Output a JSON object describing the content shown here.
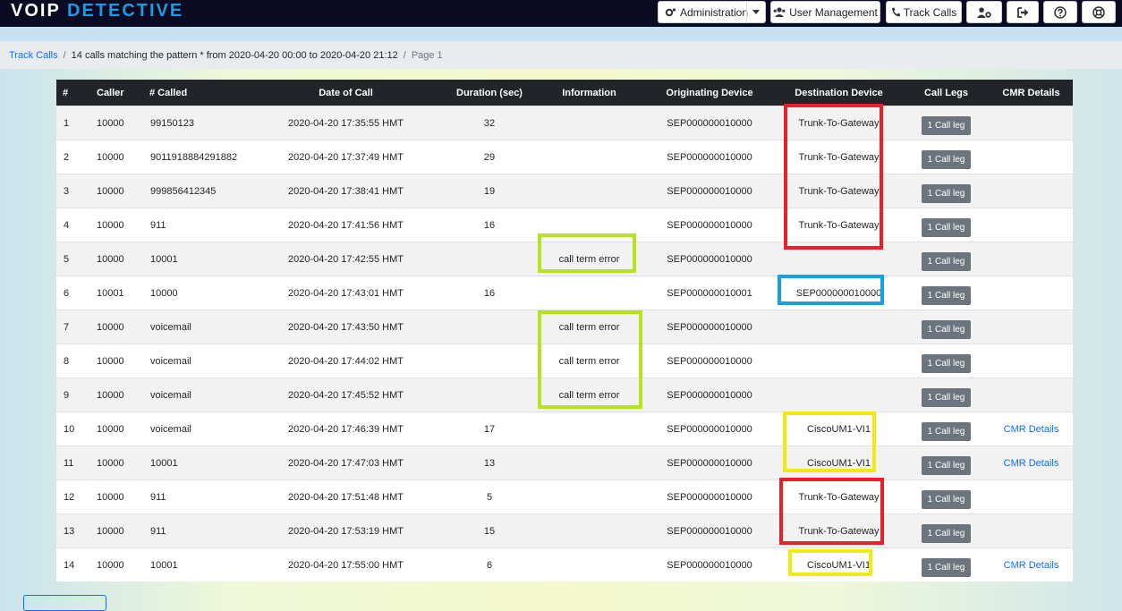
{
  "brand": {
    "part1": "VOIP",
    "part2": "DETECTIVE"
  },
  "navbar": {
    "administration": "Administration",
    "user_management": "User Management",
    "track_calls": "Track Calls"
  },
  "breadcrumb": {
    "root": "Track Calls",
    "query": "14 calls matching the pattern * from 2020-04-20 00:00 to 2020-04-20 21:12",
    "page": "Page 1"
  },
  "table": {
    "headers": [
      "#",
      "Caller",
      "# Called",
      "Date of Call",
      "Duration (sec)",
      "Information",
      "Originating Device",
      "Destination Device",
      "Call Legs",
      "CMR Details"
    ],
    "rows": [
      {
        "n": "1",
        "caller": "10000",
        "called": "99150123",
        "date": "2020-04-20 17:35:55 HMT",
        "duration": "32",
        "info": "",
        "orig": "SEP000000010000",
        "dest": "Trunk-To-Gateway",
        "legs": "1 Call leg",
        "cmr": ""
      },
      {
        "n": "2",
        "caller": "10000",
        "called": "9011918884291882",
        "date": "2020-04-20 17:37:49 HMT",
        "duration": "29",
        "info": "",
        "orig": "SEP000000010000",
        "dest": "Trunk-To-Gateway",
        "legs": "1 Call leg",
        "cmr": ""
      },
      {
        "n": "3",
        "caller": "10000",
        "called": "999856412345",
        "date": "2020-04-20 17:38:41 HMT",
        "duration": "19",
        "info": "",
        "orig": "SEP000000010000",
        "dest": "Trunk-To-Gateway",
        "legs": "1 Call leg",
        "cmr": ""
      },
      {
        "n": "4",
        "caller": "10000",
        "called": "911",
        "date": "2020-04-20 17:41:56 HMT",
        "duration": "16",
        "info": "",
        "orig": "SEP000000010000",
        "dest": "Trunk-To-Gateway",
        "legs": "1 Call leg",
        "cmr": ""
      },
      {
        "n": "5",
        "caller": "10000",
        "called": "10001",
        "date": "2020-04-20 17:42:55 HMT",
        "duration": "",
        "info": "call term error",
        "orig": "SEP000000010000",
        "dest": "",
        "legs": "1 Call leg",
        "cmr": ""
      },
      {
        "n": "6",
        "caller": "10001",
        "called": "10000",
        "date": "2020-04-20 17:43:01 HMT",
        "duration": "16",
        "info": "",
        "orig": "SEP000000010001",
        "dest": "SEP000000010000",
        "legs": "1 Call leg",
        "cmr": ""
      },
      {
        "n": "7",
        "caller": "10000",
        "called": "voicemail",
        "date": "2020-04-20 17:43:50 HMT",
        "duration": "",
        "info": "call term error",
        "orig": "SEP000000010000",
        "dest": "",
        "legs": "1 Call leg",
        "cmr": ""
      },
      {
        "n": "8",
        "caller": "10000",
        "called": "voicemail",
        "date": "2020-04-20 17:44:02 HMT",
        "duration": "",
        "info": "call term error",
        "orig": "SEP000000010000",
        "dest": "",
        "legs": "1 Call leg",
        "cmr": ""
      },
      {
        "n": "9",
        "caller": "10000",
        "called": "voicemail",
        "date": "2020-04-20 17:45:52 HMT",
        "duration": "",
        "info": "call term error",
        "orig": "SEP000000010000",
        "dest": "",
        "legs": "1 Call leg",
        "cmr": ""
      },
      {
        "n": "10",
        "caller": "10000",
        "called": "voicemail",
        "date": "2020-04-20 17:46:39 HMT",
        "duration": "17",
        "info": "",
        "orig": "SEP000000010000",
        "dest": "CiscoUM1-VI1",
        "legs": "1 Call leg",
        "cmr": "CMR Details"
      },
      {
        "n": "11",
        "caller": "10000",
        "called": "10001",
        "date": "2020-04-20 17:47:03 HMT",
        "duration": "13",
        "info": "",
        "orig": "SEP000000010000",
        "dest": "CiscoUM1-VI1",
        "legs": "1 Call leg",
        "cmr": "CMR Details"
      },
      {
        "n": "12",
        "caller": "10000",
        "called": "911",
        "date": "2020-04-20 17:51:48 HMT",
        "duration": "5",
        "info": "",
        "orig": "SEP000000010000",
        "dest": "Trunk-To-Gateway",
        "legs": "1 Call leg",
        "cmr": ""
      },
      {
        "n": "13",
        "caller": "10000",
        "called": "911",
        "date": "2020-04-20 17:53:19 HMT",
        "duration": "15",
        "info": "",
        "orig": "SEP000000010000",
        "dest": "Trunk-To-Gateway",
        "legs": "1 Call leg",
        "cmr": ""
      },
      {
        "n": "14",
        "caller": "10000",
        "called": "10001",
        "date": "2020-04-20 17:55:00 HMT",
        "duration": "6",
        "info": "",
        "orig": "SEP000000010000",
        "dest": "CiscoUM1-VI1",
        "legs": "1 Call leg",
        "cmr": "CMR Details"
      }
    ]
  },
  "colors": {
    "navbar_bg": "#0a0a23",
    "brand_accent": "#1e9be0",
    "link": "#0d6efd",
    "highlight_red": "#e8202a",
    "highlight_green": "#b5e31c",
    "highlight_blue": "#1aa0dd",
    "highlight_yellow": "#f0ea10"
  },
  "icons": [
    "cogs-icon",
    "caret-down-icon",
    "users-icon",
    "phone-icon",
    "user-cog-icon",
    "sign-out-icon",
    "question-icon",
    "life-ring-icon"
  ]
}
